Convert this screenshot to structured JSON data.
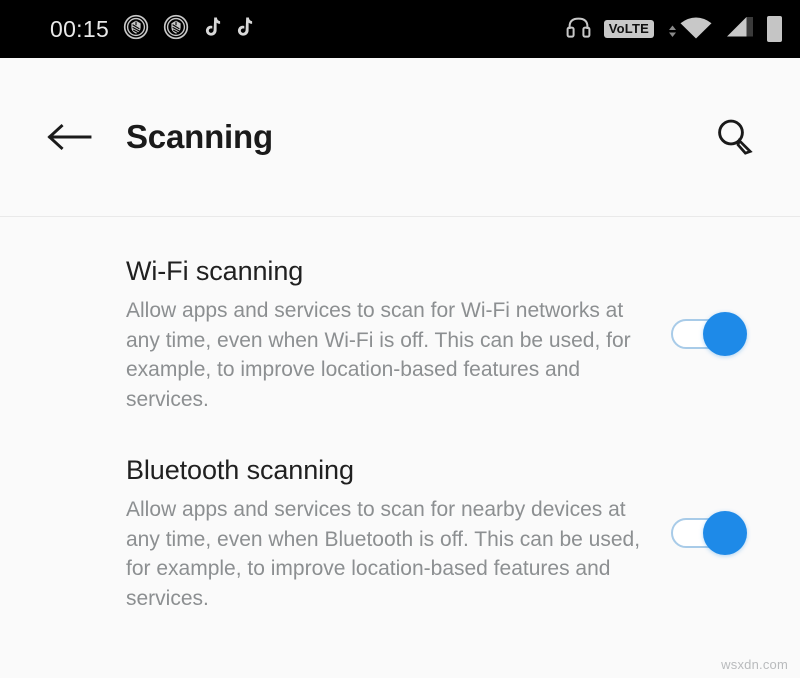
{
  "status_bar": {
    "time": "00:15",
    "background_color": "#000000",
    "icon_color": "#c8c8c8",
    "left_icons": [
      {
        "name": "shield-emblem-icon"
      },
      {
        "name": "shield-emblem-icon"
      },
      {
        "name": "tiktok-icon"
      },
      {
        "name": "tiktok-icon"
      }
    ],
    "right_icons": [
      {
        "name": "headphones-icon"
      },
      {
        "name": "volte-badge",
        "label": "VoLTE"
      },
      {
        "name": "wifi-signal-icon"
      },
      {
        "name": "cellular-signal-icon"
      },
      {
        "name": "battery-icon"
      }
    ]
  },
  "app_bar": {
    "back_label": "Back",
    "title": "Scanning",
    "search_label": "Search"
  },
  "preferences": [
    {
      "title": "Wi-Fi scanning",
      "summary": "Allow apps and services to scan for Wi-Fi networks at any time, even when Wi-Fi is off. This can be used, for example, to improve location-based features and services.",
      "toggle_state": "on"
    },
    {
      "title": "Bluetooth scanning",
      "summary": "Allow apps and services to scan for nearby devices at any time, even when Bluetooth is off. This can be used, for example, to improve location-based features and services.",
      "toggle_state": "on"
    }
  ],
  "theme": {
    "accent_color": "#1e8ae8",
    "track_color": "#a8cbe8",
    "background_color": "#fafafa",
    "title_color": "#202020",
    "summary_color": "#8c8f91"
  },
  "watermark": "wsxdn.com"
}
